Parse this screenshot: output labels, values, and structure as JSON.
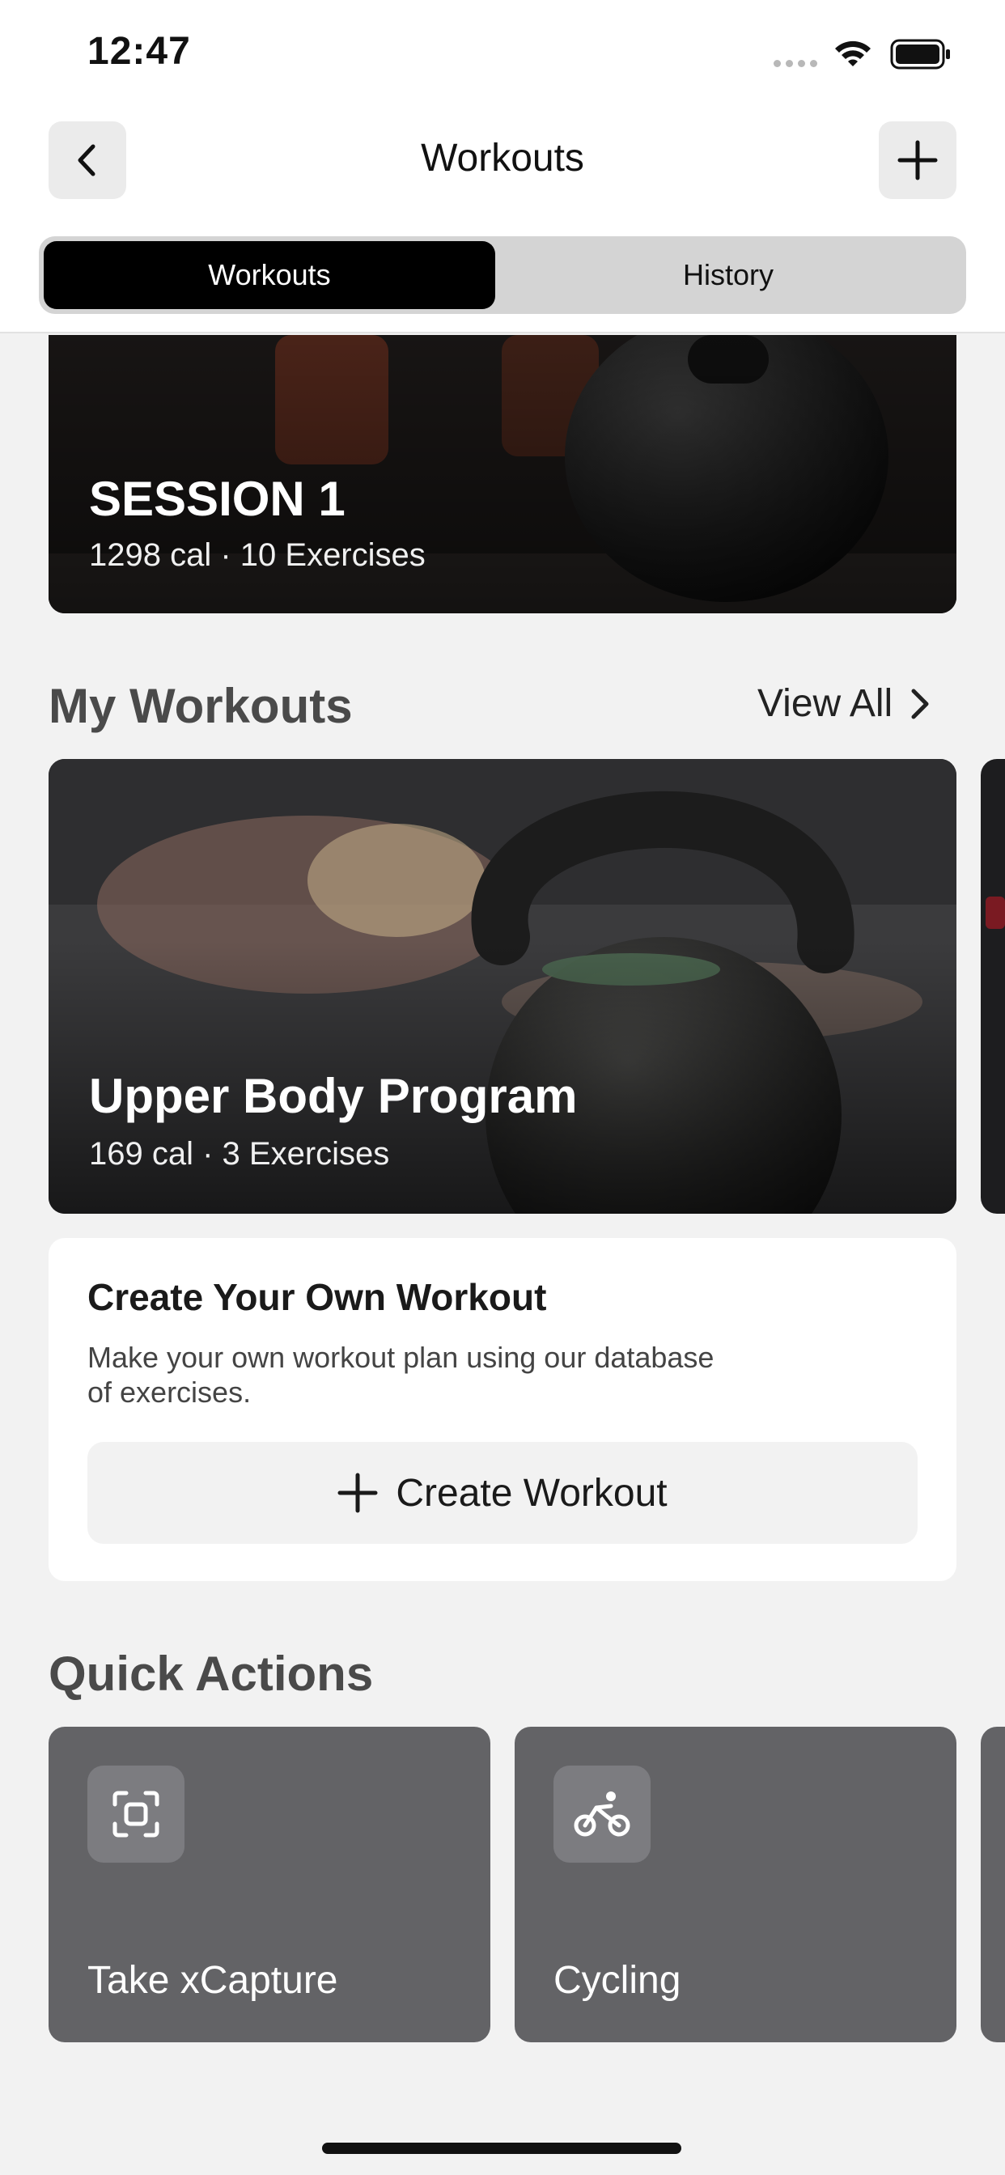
{
  "status_bar": {
    "time": "12:47"
  },
  "nav": {
    "title": "Workouts"
  },
  "segments": {
    "active": "Workouts",
    "inactive": "History"
  },
  "featured": {
    "title": "SESSION 1",
    "subtitle": "1298 cal · 10 Exercises"
  },
  "my_workouts": {
    "heading": "My Workouts",
    "view_all": "View All",
    "card": {
      "title": "Upper Body Program",
      "subtitle": "169 cal · 3 Exercises"
    }
  },
  "create": {
    "title": "Create Your Own Workout",
    "desc_line1": "Make your own workout plan using our database",
    "desc_line2": "of exercises.",
    "button": "Create Workout"
  },
  "quick_actions": {
    "heading": "Quick Actions",
    "items": [
      {
        "label": "Take xCapture",
        "icon": "scan-icon"
      },
      {
        "label": "Cycling",
        "icon": "bicycle-icon"
      }
    ]
  }
}
